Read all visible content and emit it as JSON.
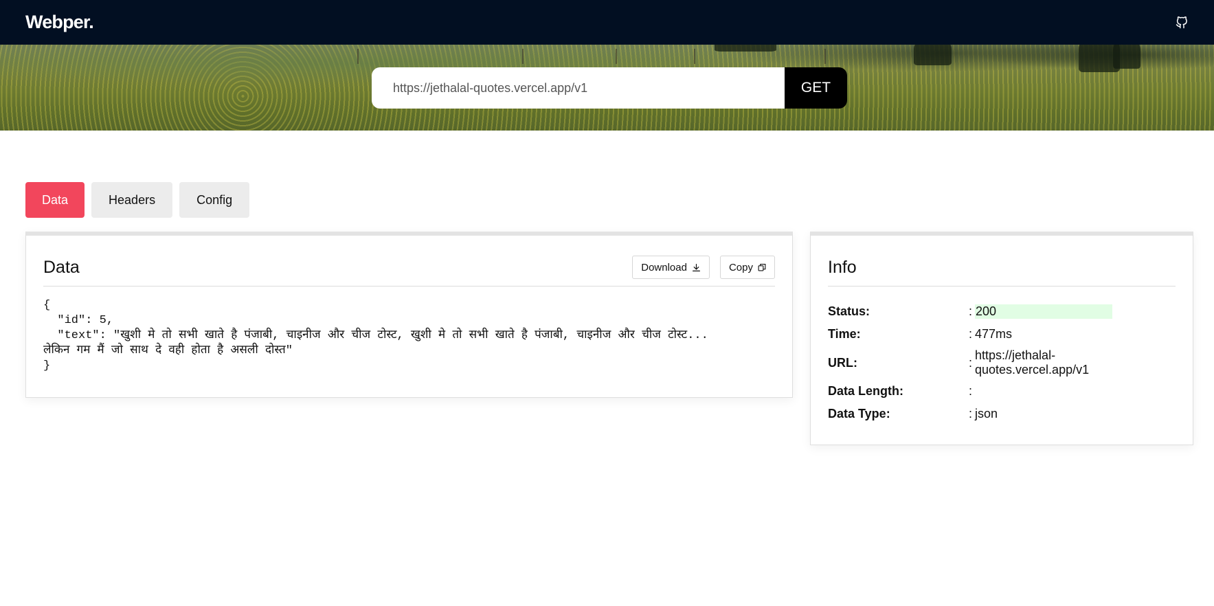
{
  "navbar": {
    "brand": "Webper.",
    "github_icon": "github-icon"
  },
  "request": {
    "url": "https://jethalal-quotes.vercel.app/v1",
    "method_label": "GET"
  },
  "tabs": [
    {
      "label": "Data",
      "active": true
    },
    {
      "label": "Headers",
      "active": false
    },
    {
      "label": "Config",
      "active": false
    }
  ],
  "data_panel": {
    "title": "Data",
    "download_label": "Download",
    "download_icon": "download-icon",
    "copy_label": "Copy",
    "copy_icon": "copy-icon",
    "json_text": "{\n  \"id\": 5,\n  \"text\": \"खुशी मे तो सभी खाते है पंजाबी, चाइनीज और चीज टोस्ट, खुशी मे तो सभी खाते है पंजाबी, चाइनीज और चीज टोस्ट... लेकिन गम मैं जो साथ दे वही होता है असली दोस्त\"\n}"
  },
  "info_panel": {
    "title": "Info",
    "rows": [
      {
        "label": "Status:",
        "colon": ":",
        "value": "200"
      },
      {
        "label": "Time:",
        "colon": ":",
        "value": "477ms"
      },
      {
        "label": "URL:",
        "colon": ":",
        "value": "https://jethalal-quotes.vercel.app/v1"
      },
      {
        "label": "Data Length:",
        "colon": ":",
        "value": ""
      },
      {
        "label": "Data Type:",
        "colon": ":",
        "value": "json"
      }
    ]
  },
  "colors": {
    "navbar_bg": "#020f22",
    "active_tab": "#f2465c",
    "status_highlight": "#e1fde4"
  }
}
